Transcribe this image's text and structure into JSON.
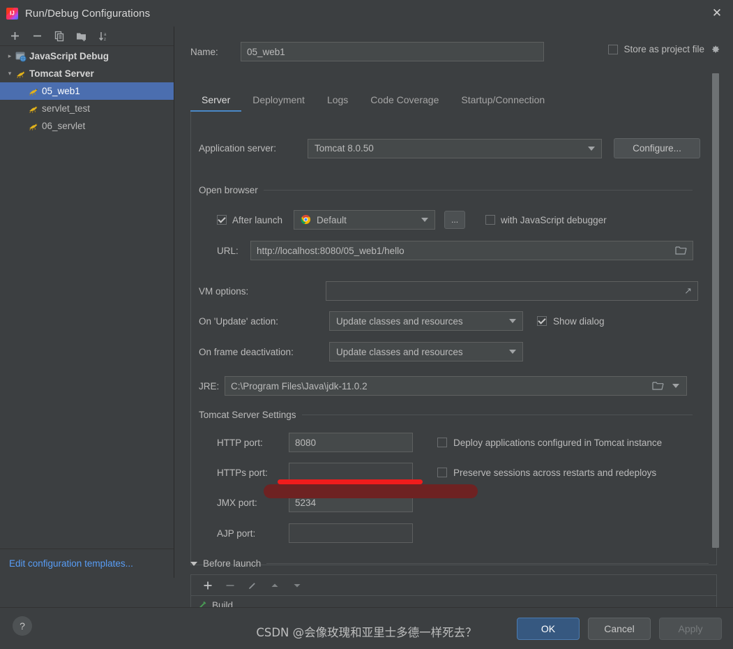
{
  "window": {
    "title": "Run/Debug Configurations",
    "app_icon": "intellij-idea-icon",
    "close_icon": "close-icon"
  },
  "sidebar": {
    "toolbar": [
      {
        "name": "add-configuration-button",
        "icon": "plus-icon",
        "label": "+"
      },
      {
        "name": "remove-configuration-button",
        "icon": "minus-icon",
        "label": "−"
      },
      {
        "name": "copy-configuration-button",
        "icon": "copy-icon",
        "label": "copy"
      },
      {
        "name": "save-configuration-button",
        "icon": "folder-add-icon",
        "label": "folder"
      },
      {
        "name": "sort-configurations-button",
        "icon": "sort-alpha-icon",
        "label": "sort"
      }
    ],
    "tree": [
      {
        "label": "JavaScript Debug",
        "icon": "javascript-debug-icon",
        "expanded": false,
        "arrow": "›",
        "level": 0,
        "bold": true,
        "selected": false
      },
      {
        "label": "Tomcat Server",
        "icon": "tomcat-icon",
        "expanded": true,
        "arrow": "⌄",
        "level": 0,
        "bold": true,
        "selected": false
      },
      {
        "label": "05_web1",
        "icon": "tomcat-icon",
        "level": 1,
        "bold": false,
        "selected": true
      },
      {
        "label": "servlet_test",
        "icon": "tomcat-icon",
        "level": 1,
        "bold": false,
        "selected": false
      },
      {
        "label": "06_servlet",
        "icon": "tomcat-icon",
        "level": 1,
        "bold": false,
        "selected": false
      }
    ],
    "edit_templates_link": "Edit configuration templates..."
  },
  "header": {
    "name_label": "Name:",
    "name_value": "05_web1",
    "store_as_project_file_label": "Store as project file",
    "store_as_project_file_checked": false,
    "settings_icon": "gear-icon"
  },
  "tabs": [
    {
      "label": "Server",
      "active": true
    },
    {
      "label": "Deployment",
      "active": false
    },
    {
      "label": "Logs",
      "active": false
    },
    {
      "label": "Code Coverage",
      "active": false
    },
    {
      "label": "Startup/Connection",
      "active": false
    }
  ],
  "server_tab": {
    "application_server_label": "Application server:",
    "application_server_value": "Tomcat 8.0.50",
    "configure_button": "Configure...",
    "open_browser_group": "Open browser",
    "after_launch_label": "After launch",
    "after_launch_checked": true,
    "browser_value": "Default",
    "browser_icon": "chrome-icon",
    "browse_button": "...",
    "with_js_debugger_label": "with JavaScript debugger",
    "with_js_debugger_checked": false,
    "url_label": "URL:",
    "url_value": "http://localhost:8080/05_web1/hello",
    "url_folder_icon": "folder-icon",
    "vm_options_label": "VM options:",
    "vm_options_value": "",
    "vm_options_expand_icon": "expand-icon",
    "on_update_label": "On 'Update' action:",
    "on_update_value": "Update classes and resources",
    "show_dialog_label": "Show dialog",
    "show_dialog_checked": true,
    "on_frame_deactivation_label": "On frame deactivation:",
    "on_frame_deactivation_value": "Update classes and resources",
    "jre_label": "JRE:",
    "jre_value": "C:\\Program Files\\Java\\jdk-11.0.2",
    "jre_folder_icon": "folder-icon",
    "jre_dropdown_icon": "chevron-down-icon",
    "tomcat_settings_group": "Tomcat Server Settings",
    "http_port_label": "HTTP port:",
    "http_port_value": "8080",
    "https_port_label": "HTTPs port:",
    "https_port_value": "",
    "jmx_port_label": "JMX port:",
    "jmx_port_value": "5234",
    "ajp_port_label": "AJP port:",
    "ajp_port_value": "",
    "deploy_apps_label": "Deploy applications configured in Tomcat instance",
    "deploy_apps_checked": false,
    "preserve_sessions_label": "Preserve sessions across restarts and redeploys",
    "preserve_sessions_checked": false
  },
  "before_launch": {
    "title": "Before launch",
    "expanded": true,
    "toolbar": [
      {
        "name": "add-task-button",
        "icon": "plus-icon"
      },
      {
        "name": "remove-task-button",
        "icon": "minus-icon"
      },
      {
        "name": "edit-task-button",
        "icon": "pencil-icon"
      },
      {
        "name": "move-up-button",
        "icon": "arrow-up-icon"
      },
      {
        "name": "move-down-button",
        "icon": "arrow-down-icon"
      }
    ],
    "tasks": [
      {
        "label": "Build",
        "icon": "build-hammer-icon"
      }
    ]
  },
  "footer": {
    "help_label": "?",
    "ok_label": "OK",
    "cancel_label": "Cancel",
    "apply_label": "Apply",
    "apply_disabled": true,
    "ok_color": "#365880"
  },
  "watermark": "CSDN @会像玫瑰和亚里士多德一样死去？"
}
